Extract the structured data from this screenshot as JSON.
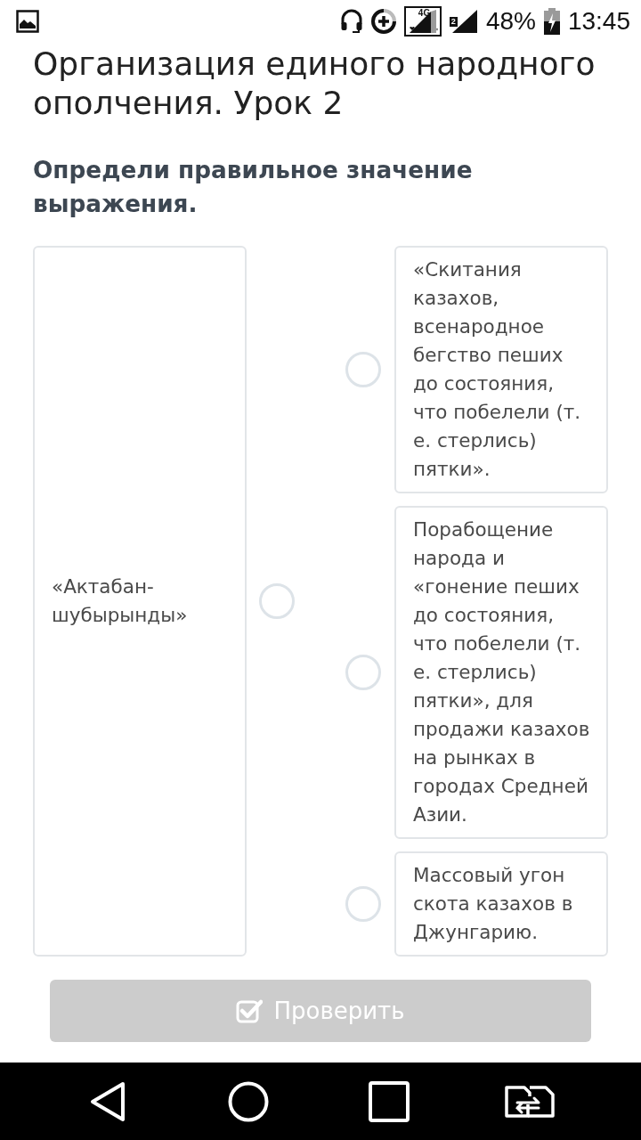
{
  "status_bar": {
    "network_type": "4G",
    "sim_slot": "2",
    "battery": "48%",
    "time": "13:45"
  },
  "lesson_title": "Организация единого народного ополчения. Урок 2",
  "question": "Определи правильное значение выражения.",
  "terms": [
    {
      "text": "«Актабан-шубырынды»",
      "selected": false
    }
  ],
  "definitions": [
    {
      "text": "«Скитания казахов, всенародное бегство пеших до состояния, что побелели (т. е. стерлись) пятки».",
      "selected": false
    },
    {
      "text": "Порабощение народа и «гонение пеших до состояния, что побелели (т. е. стерлись) пятки», для продажи казахов на рынках в городах Средней Азии.",
      "selected": false
    },
    {
      "text": "Массовый угон скота казахов в Джунгарию.",
      "selected": false
    }
  ],
  "check_button": {
    "label": "Проверить",
    "disabled": true
  }
}
